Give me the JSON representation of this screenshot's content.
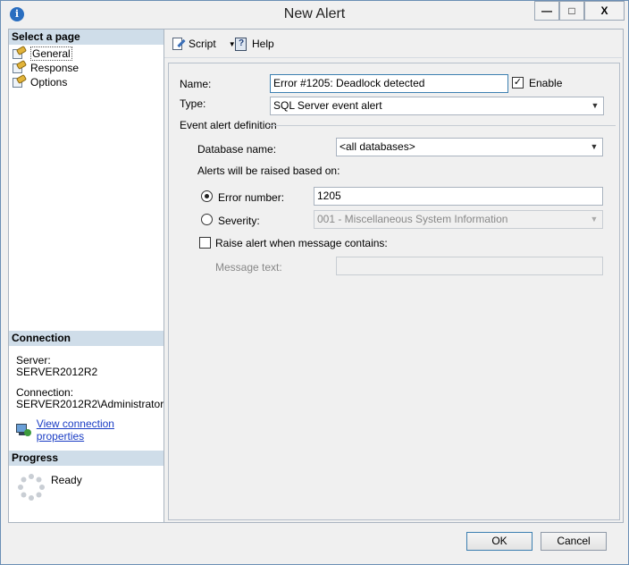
{
  "window": {
    "title": "New Alert",
    "min_glyph": "—",
    "max_glyph": "□",
    "close_glyph": "X"
  },
  "left_pane": {
    "select_page_header": "Select a page",
    "pages": [
      {
        "label": "General",
        "icon": "page-wrench-icon",
        "selected": true
      },
      {
        "label": "Response",
        "icon": "page-wrench-icon",
        "selected": false
      },
      {
        "label": "Options",
        "icon": "page-wrench-icon",
        "selected": false
      }
    ],
    "connection_header": "Connection",
    "server_label": "Server:",
    "server_value": "SERVER2012R2",
    "connection_label": "Connection:",
    "connection_value": "SERVER2012R2\\Administrator",
    "view_connection_link": "View connection properties",
    "progress_header": "Progress",
    "progress_status": "Ready"
  },
  "toolbar": {
    "script_label": "Script",
    "help_label": "Help"
  },
  "form": {
    "name_label": "Name:",
    "name_value": "Error #1205: Deadlock detected",
    "enable_label": "Enable",
    "enable_checked": true,
    "type_label": "Type:",
    "type_value": "SQL Server event alert",
    "event_alert_definition": "Event alert definition",
    "database_name_label": "Database name:",
    "database_name_value": "<all databases>",
    "alerts_raised_label": "Alerts will be raised based on:",
    "error_number_label": "Error number:",
    "error_number_value": "1205",
    "error_number_selected": true,
    "severity_label": "Severity:",
    "severity_value": "001 - Miscellaneous System Information",
    "raise_alert_label": "Raise alert when message contains:",
    "raise_alert_checked": false,
    "message_text_label": "Message text:",
    "message_text_value": ""
  },
  "buttons": {
    "ok": "OK",
    "cancel": "Cancel"
  },
  "colors": {
    "section_header_bg": "#cfdde9",
    "link": "#1a3dc4",
    "app_icon": "#2a6ec0"
  }
}
